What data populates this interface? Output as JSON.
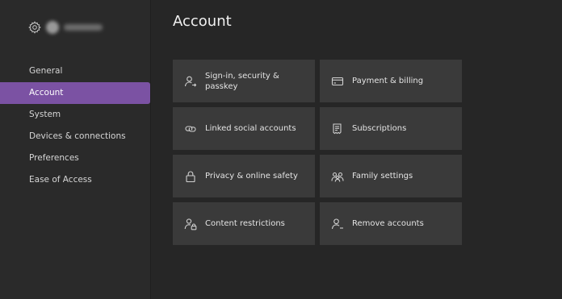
{
  "sidebar": {
    "items": [
      {
        "label": "General",
        "active": false
      },
      {
        "label": "Account",
        "active": true
      },
      {
        "label": "System",
        "active": false
      },
      {
        "label": "Devices & connections",
        "active": false
      },
      {
        "label": "Preferences",
        "active": false
      },
      {
        "label": "Ease of Access",
        "active": false
      }
    ]
  },
  "main": {
    "title": "Account",
    "tiles": [
      {
        "label": "Sign-in, security & passkey",
        "icon": "person-arrow-icon"
      },
      {
        "label": "Payment & billing",
        "icon": "card-icon"
      },
      {
        "label": "Linked social accounts",
        "icon": "link-icon"
      },
      {
        "label": "Subscriptions",
        "icon": "receipt-icon"
      },
      {
        "label": "Privacy & online safety",
        "icon": "lock-icon"
      },
      {
        "label": "Family settings",
        "icon": "family-icon"
      },
      {
        "label": "Content restrictions",
        "icon": "person-lock-icon"
      },
      {
        "label": "Remove accounts",
        "icon": "person-remove-icon"
      }
    ]
  },
  "colors": {
    "accent": "#7b52a3",
    "background": "#262626",
    "sidebar": "#2a2a2a",
    "tile": "#3a3a3a"
  }
}
